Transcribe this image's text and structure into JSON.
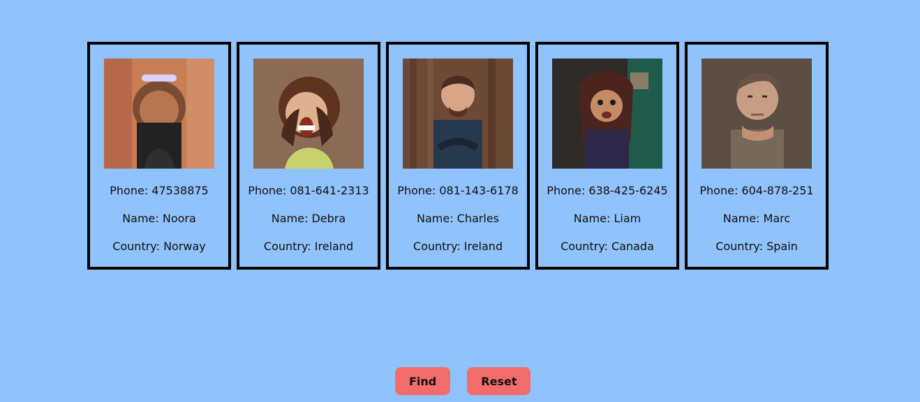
{
  "colors": {
    "background": "#90c2fb",
    "card_border": "#000000",
    "button": "#f36c6c"
  },
  "cards": [
    {
      "avatar": "person-noora",
      "phone_text": "Phone: 47538875",
      "name_text": "Name: Noora",
      "country_text": "Country: Norway"
    },
    {
      "avatar": "person-debra",
      "phone_text": "Phone: 081-641-2313",
      "name_text": "Name: Debra",
      "country_text": "Country: Ireland"
    },
    {
      "avatar": "person-charles",
      "phone_text": "Phone: 081-143-6178",
      "name_text": "Name: Charles",
      "country_text": "Country: Ireland"
    },
    {
      "avatar": "person-liam",
      "phone_text": "Phone: 638-425-6245",
      "name_text": "Name: Liam",
      "country_text": "Country: Canada"
    },
    {
      "avatar": "person-marc",
      "phone_text": "Phone: 604-878-251",
      "name_text": "Name: Marc",
      "country_text": "Country: Spain"
    }
  ],
  "buttons": {
    "find_label": "Find",
    "reset_label": "Reset"
  }
}
